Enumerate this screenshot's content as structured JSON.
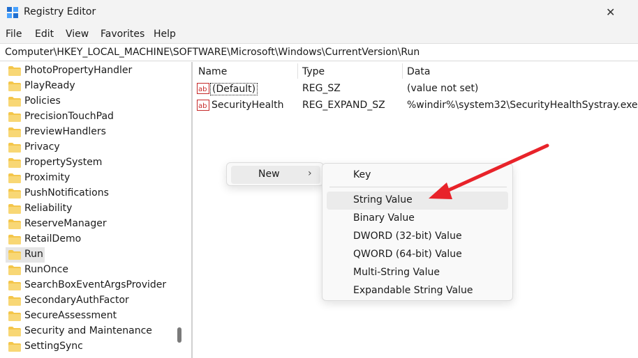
{
  "window": {
    "title": "Registry Editor",
    "close_glyph": "✕"
  },
  "menu": [
    "File",
    "Edit",
    "View",
    "Favorites",
    "Help"
  ],
  "address": "Computer\\HKEY_LOCAL_MACHINE\\SOFTWARE\\Microsoft\\Windows\\CurrentVersion\\Run",
  "tree": {
    "items": [
      "PhotoPropertyHandler",
      "PlayReady",
      "Policies",
      "PrecisionTouchPad",
      "PreviewHandlers",
      "Privacy",
      "PropertySystem",
      "Proximity",
      "PushNotifications",
      "Reliability",
      "ReserveManager",
      "RetailDemo",
      "Run",
      "RunOnce",
      "SearchBoxEventArgsProvider",
      "SecondaryAuthFactor",
      "SecureAssessment",
      "Security and Maintenance",
      "SettingSync"
    ],
    "selected": "Run"
  },
  "values_pane": {
    "columns": [
      "Name",
      "Type",
      "Data"
    ],
    "rows": [
      {
        "name": "(Default)",
        "type": "REG_SZ",
        "data": "(value not set)"
      },
      {
        "name": "SecurityHealth",
        "type": "REG_EXPAND_SZ",
        "data": "%windir%\\system32\\SecurityHealthSystray.exe"
      }
    ]
  },
  "context_menu": {
    "label": "New",
    "chevron": "›",
    "submenu": [
      "Key",
      "String Value",
      "Binary Value",
      "DWORD (32-bit) Value",
      "QWORD (64-bit) Value",
      "Multi-String Value",
      "Expandable String Value"
    ],
    "highlighted": "String Value"
  },
  "icons": {
    "app": "registry-editor-icon",
    "folder": "folder-icon",
    "value": "string-value-icon",
    "annotation": "red-arrow-annotation"
  },
  "colors": {
    "titlebar": "#f3f3f3",
    "folder": "#f4c64a",
    "selection": "#e5e5e5",
    "arrow": "#e8232a",
    "value_icon_red": "#c62828"
  }
}
